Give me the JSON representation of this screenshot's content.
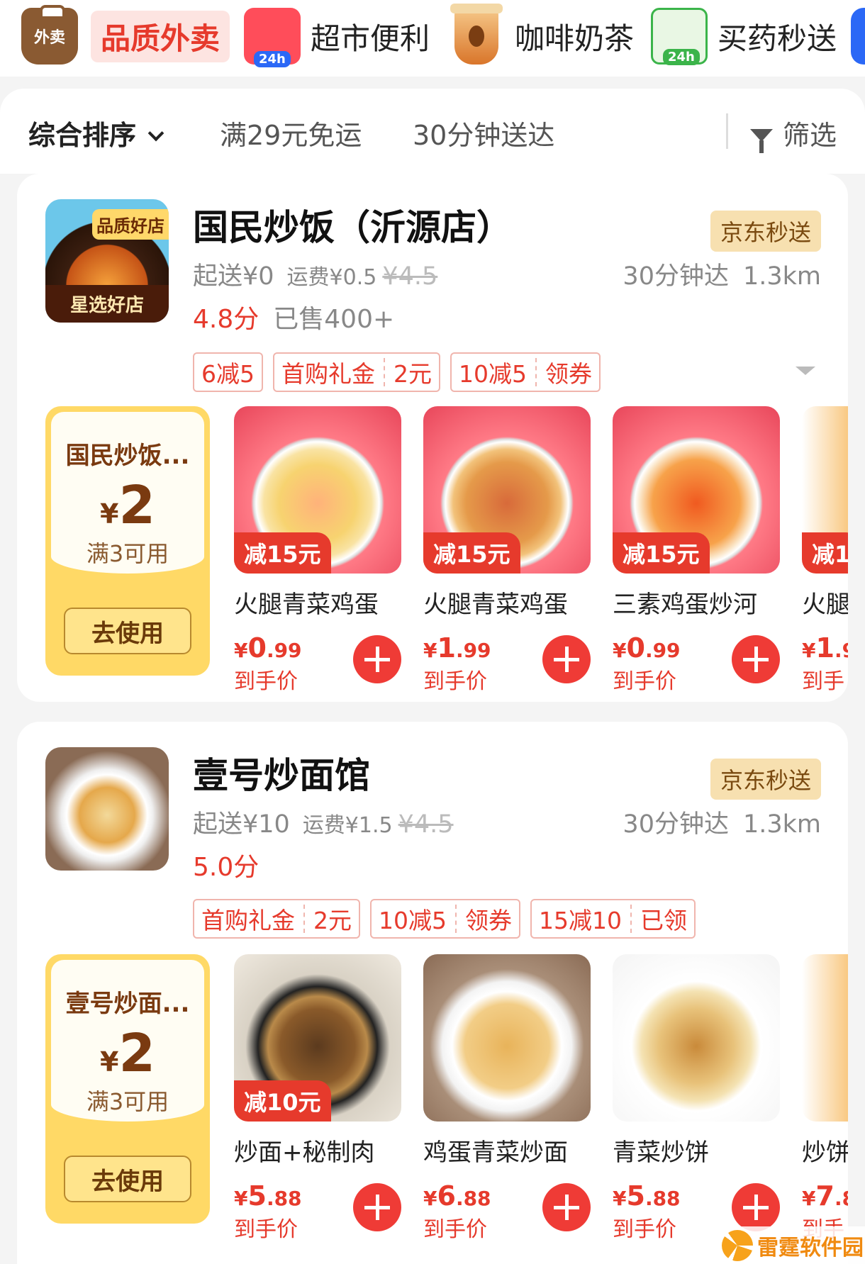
{
  "top_categories": [
    {
      "label": "品质外卖",
      "icon": "takeout-bag-icon",
      "icon_text": "外卖",
      "active": true
    },
    {
      "label": "超市便利",
      "icon": "supermarket-icon",
      "icon_badge": "24h",
      "active": false
    },
    {
      "label": "咖啡奶茶",
      "icon": "coffee-cup-icon",
      "active": false
    },
    {
      "label": "买药秒送",
      "icon": "medicine-icon",
      "icon_badge": "24h",
      "active": false
    }
  ],
  "sort_bar": {
    "sort": "综合排序",
    "free_delivery": "满29元免运",
    "fast": "30分钟送达",
    "filter": "筛选"
  },
  "shops": [
    {
      "logo_badge": "品质好店",
      "logo_footer": "星选好店",
      "name": "国民炒饭（沂源店）",
      "badge": "京东秒送",
      "min_order": "起送¥0",
      "fee": "运费¥0.5",
      "fee_orig": "¥4.5",
      "time": "30分钟达",
      "distance": "1.3km",
      "rating": "4.8分",
      "sold": "已售400+",
      "tags": [
        {
          "a": "6减5"
        },
        {
          "a": "首购礼金",
          "b": "2元"
        },
        {
          "a": "10减5",
          "b": "领券"
        }
      ],
      "coupon": {
        "name": "国民炒饭...",
        "yen": "¥",
        "amount": "2",
        "cond": "满3可用",
        "button": "去使用"
      },
      "products": [
        {
          "name": "火腿青菜鸡蛋",
          "discount": "减15元",
          "yen": "¥",
          "price_int": "0",
          "price_dec": ".99",
          "sub": "到手价",
          "img": "fried-rice"
        },
        {
          "name": "火腿青菜鸡蛋",
          "discount": "减15元",
          "yen": "¥",
          "price_int": "1",
          "price_dec": ".99",
          "sub": "到手价",
          "img": "fried-noodle"
        },
        {
          "name": "三素鸡蛋炒河",
          "discount": "减15元",
          "yen": "¥",
          "price_int": "0",
          "price_dec": ".99",
          "sub": "到手价",
          "img": "fried-hefen"
        },
        {
          "name": "火腿",
          "discount": "减1",
          "yen": "¥",
          "price_int": "1",
          "price_dec": ".9",
          "sub": "到手",
          "img": "partial"
        }
      ]
    },
    {
      "name": "壹号炒面馆",
      "badge": "京东秒送",
      "min_order": "起送¥10",
      "fee": "运费¥1.5",
      "fee_orig": "¥4.5",
      "time": "30分钟达",
      "distance": "1.3km",
      "rating": "5.0分",
      "tags": [
        {
          "a": "首购礼金",
          "b": "2元"
        },
        {
          "a": "10减5",
          "b": "领券"
        },
        {
          "a": "15减10",
          "b": "已领"
        }
      ],
      "coupon": {
        "name": "壹号炒面...",
        "yen": "¥",
        "amount": "2",
        "cond": "满3可用",
        "button": "去使用"
      },
      "products": [
        {
          "name": "炒面+秘制肉",
          "discount": "减10元",
          "yen": "¥",
          "price_int": "5",
          "price_dec": ".88",
          "sub": "到手价",
          "img": "dark-noodle"
        },
        {
          "name": "鸡蛋青菜炒面",
          "yen": "¥",
          "price_int": "6",
          "price_dec": ".88",
          "sub": "到手价",
          "img": "egg-noodle"
        },
        {
          "name": "青菜炒饼",
          "yen": "¥",
          "price_int": "5",
          "price_dec": ".88",
          "sub": "到手价",
          "img": "fried-bing"
        },
        {
          "name": "炒饼",
          "yen": "¥",
          "price_int": "7",
          "price_dec": ".8",
          "sub": "到手",
          "img": "partial"
        }
      ]
    }
  ],
  "watermark": "雷霆软件园"
}
